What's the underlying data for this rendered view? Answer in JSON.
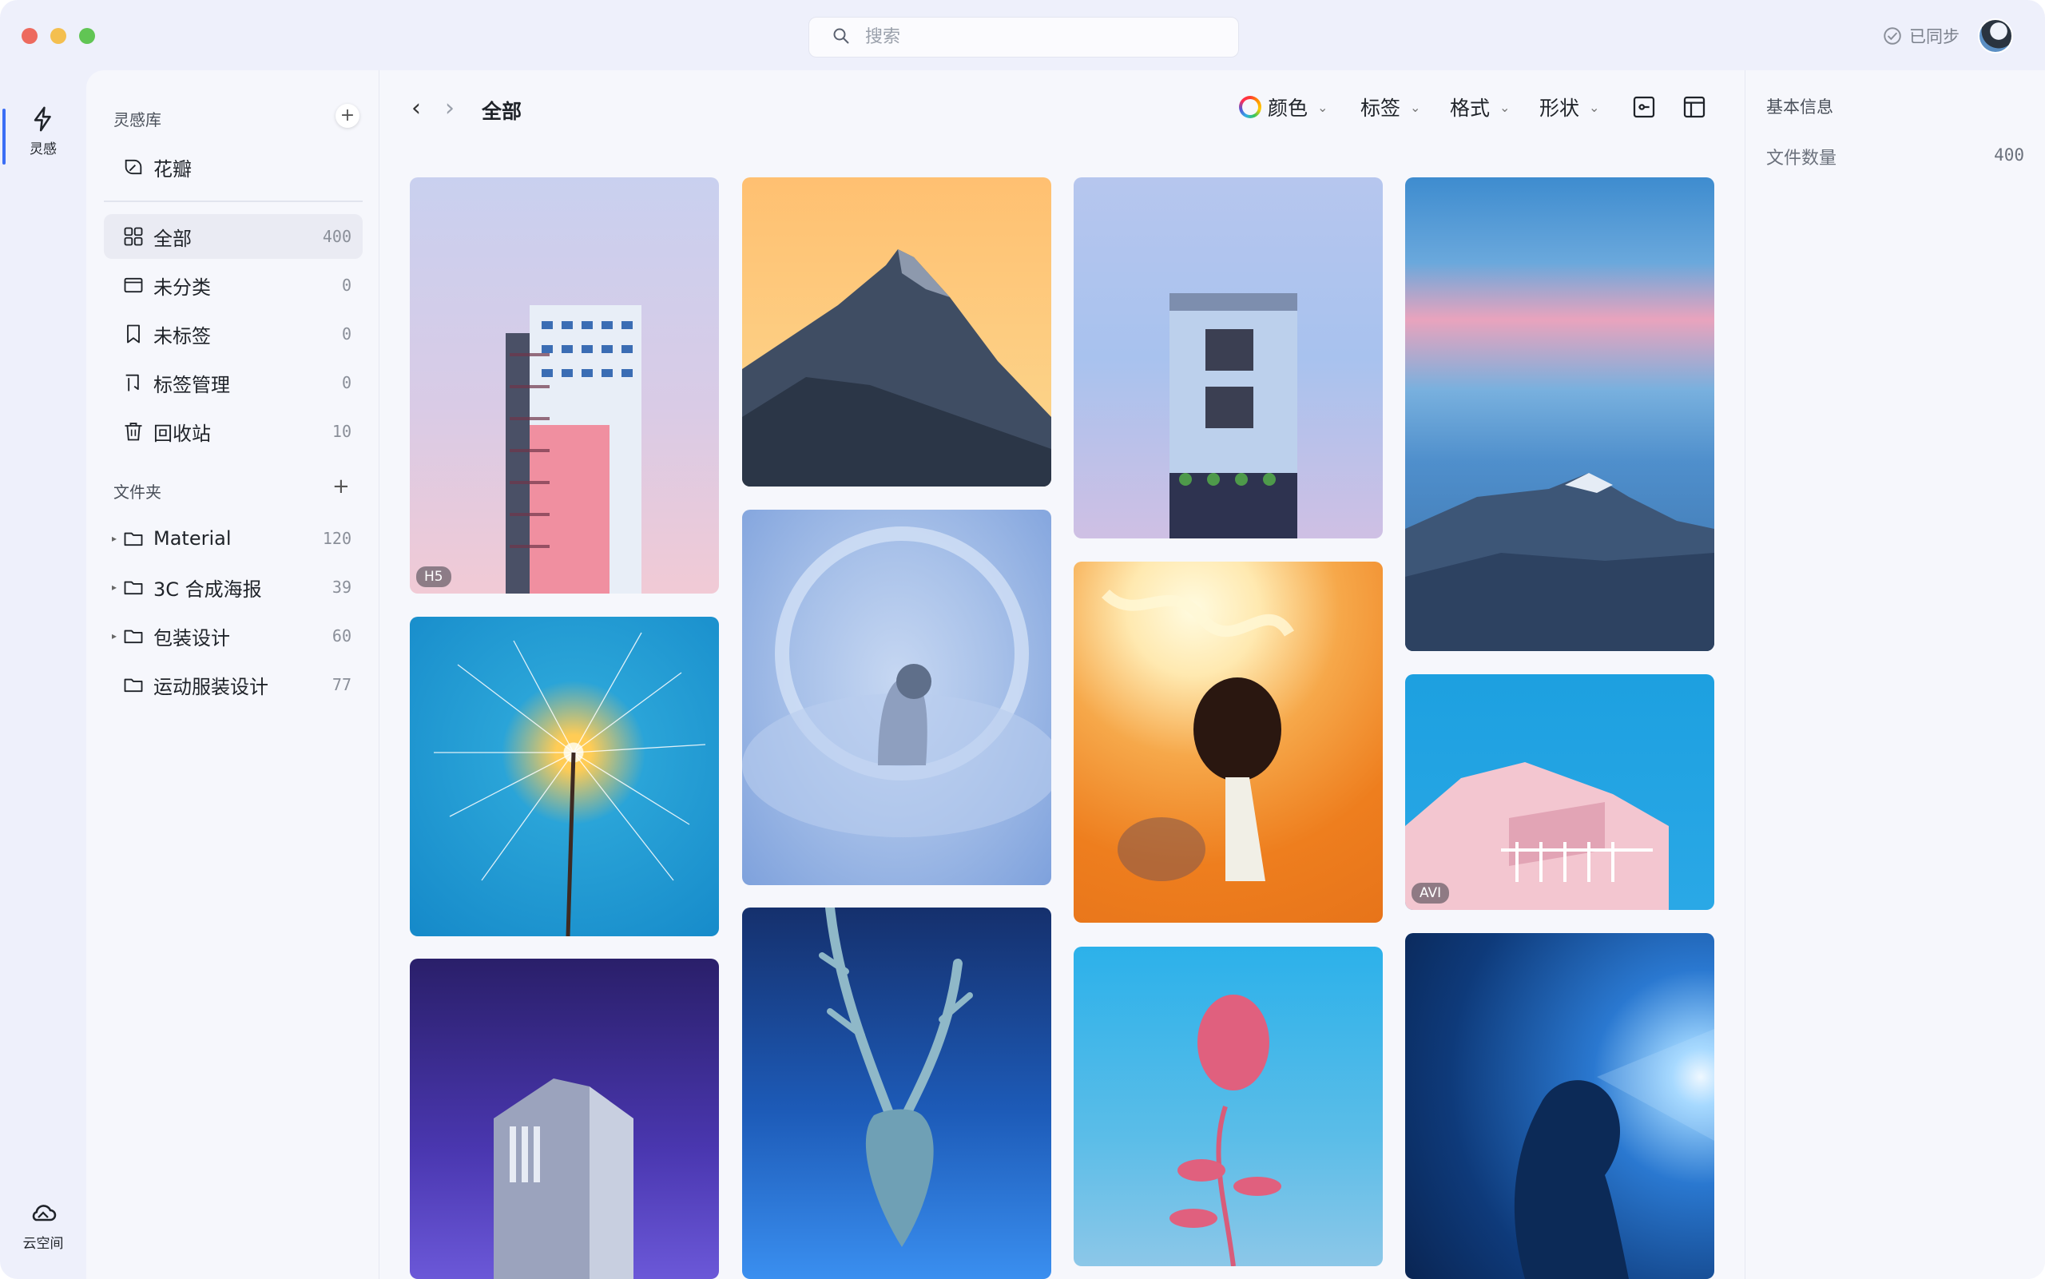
{
  "search": {
    "placeholder": "搜索"
  },
  "header": {
    "sync_label": "已同步"
  },
  "rail": {
    "inspiration_label": "灵感",
    "cloud_label": "云空间"
  },
  "library": {
    "title": "灵感库",
    "current": "花瓣",
    "items": [
      {
        "label": "全部",
        "count": "400",
        "icon": "grid-icon"
      },
      {
        "label": "未分类",
        "count": "0",
        "icon": "window-icon"
      },
      {
        "label": "未标签",
        "count": "0",
        "icon": "bookmark-icon"
      },
      {
        "label": "标签管理",
        "count": "0",
        "icon": "tag-manage-icon"
      },
      {
        "label": "回收站",
        "count": "10",
        "icon": "trash-icon"
      }
    ]
  },
  "folders": {
    "title": "文件夹",
    "items": [
      {
        "label": "Material",
        "count": "120",
        "expandable": true
      },
      {
        "label": "3C 合成海报",
        "count": "39",
        "expandable": true
      },
      {
        "label": "包装设计",
        "count": "60",
        "expandable": true
      },
      {
        "label": "运动服装设计",
        "count": "77",
        "expandable": false
      }
    ]
  },
  "main": {
    "breadcrumb": "全部",
    "filters": {
      "color": "颜色",
      "tags": "标签",
      "format": "格式",
      "shape": "形状"
    }
  },
  "gallery": {
    "badges": {
      "card1": "H5",
      "card8": "AVI"
    }
  },
  "info": {
    "title": "基本信息",
    "file_count_label": "文件数量",
    "file_count_value": "400"
  },
  "colors": {
    "accent": "#3b6ef5",
    "window_bg": "#eef0fb",
    "panel_bg": "#f6f7fc"
  }
}
